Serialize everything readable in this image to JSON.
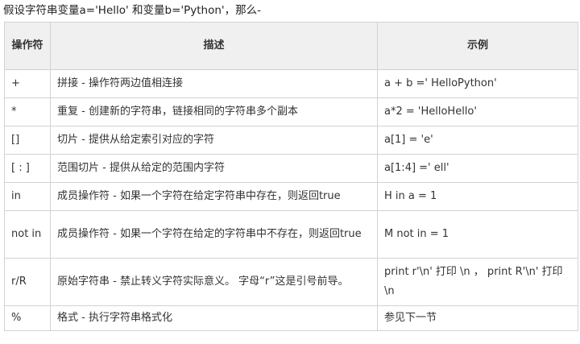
{
  "intro": "假设字符串变量a='Hello' 和变量b='Python'，那么-",
  "table": {
    "headers": {
      "operator": "操作符",
      "description": "描述",
      "example": "示例"
    },
    "rows": [
      {
        "op": "+",
        "desc": "拼接 - 操作符两边值相连接",
        "example": "a + b =' HelloPython'"
      },
      {
        "op": "*",
        "desc": "重复 - 创建新的字符串，链接相同的字符串多个副本",
        "example": "a*2 = 'HelloHello'"
      },
      {
        "op": "[]",
        "desc": "切片 - 提供从给定索引对应的字符",
        "example": "a[1] = 'e'"
      },
      {
        "op": "[ : ]",
        "desc": "范围切片 - 提供从给定的范围内字符",
        "example": "a[1:4] =' ell'"
      },
      {
        "op": "in",
        "desc": "成员操作符 - 如果一个字符在给定字符串中存在，则返回true",
        "example": "H in a = 1"
      },
      {
        "op": "not in",
        "desc": "成员操作符 - 如果一个字符在给定的字符串中不存在，则返回true",
        "example": "M not in = 1"
      },
      {
        "op": "r/R",
        "desc": "原始字符串 - 禁止转义字符实际意义。 字母“r”这是引号前导。",
        "example": "print r'\\n' 打印 \\n ， print R'\\n' 打印 \\n"
      },
      {
        "op": "%",
        "desc": "格式 - 执行字符串格式化",
        "example": "参见下一节"
      }
    ]
  }
}
